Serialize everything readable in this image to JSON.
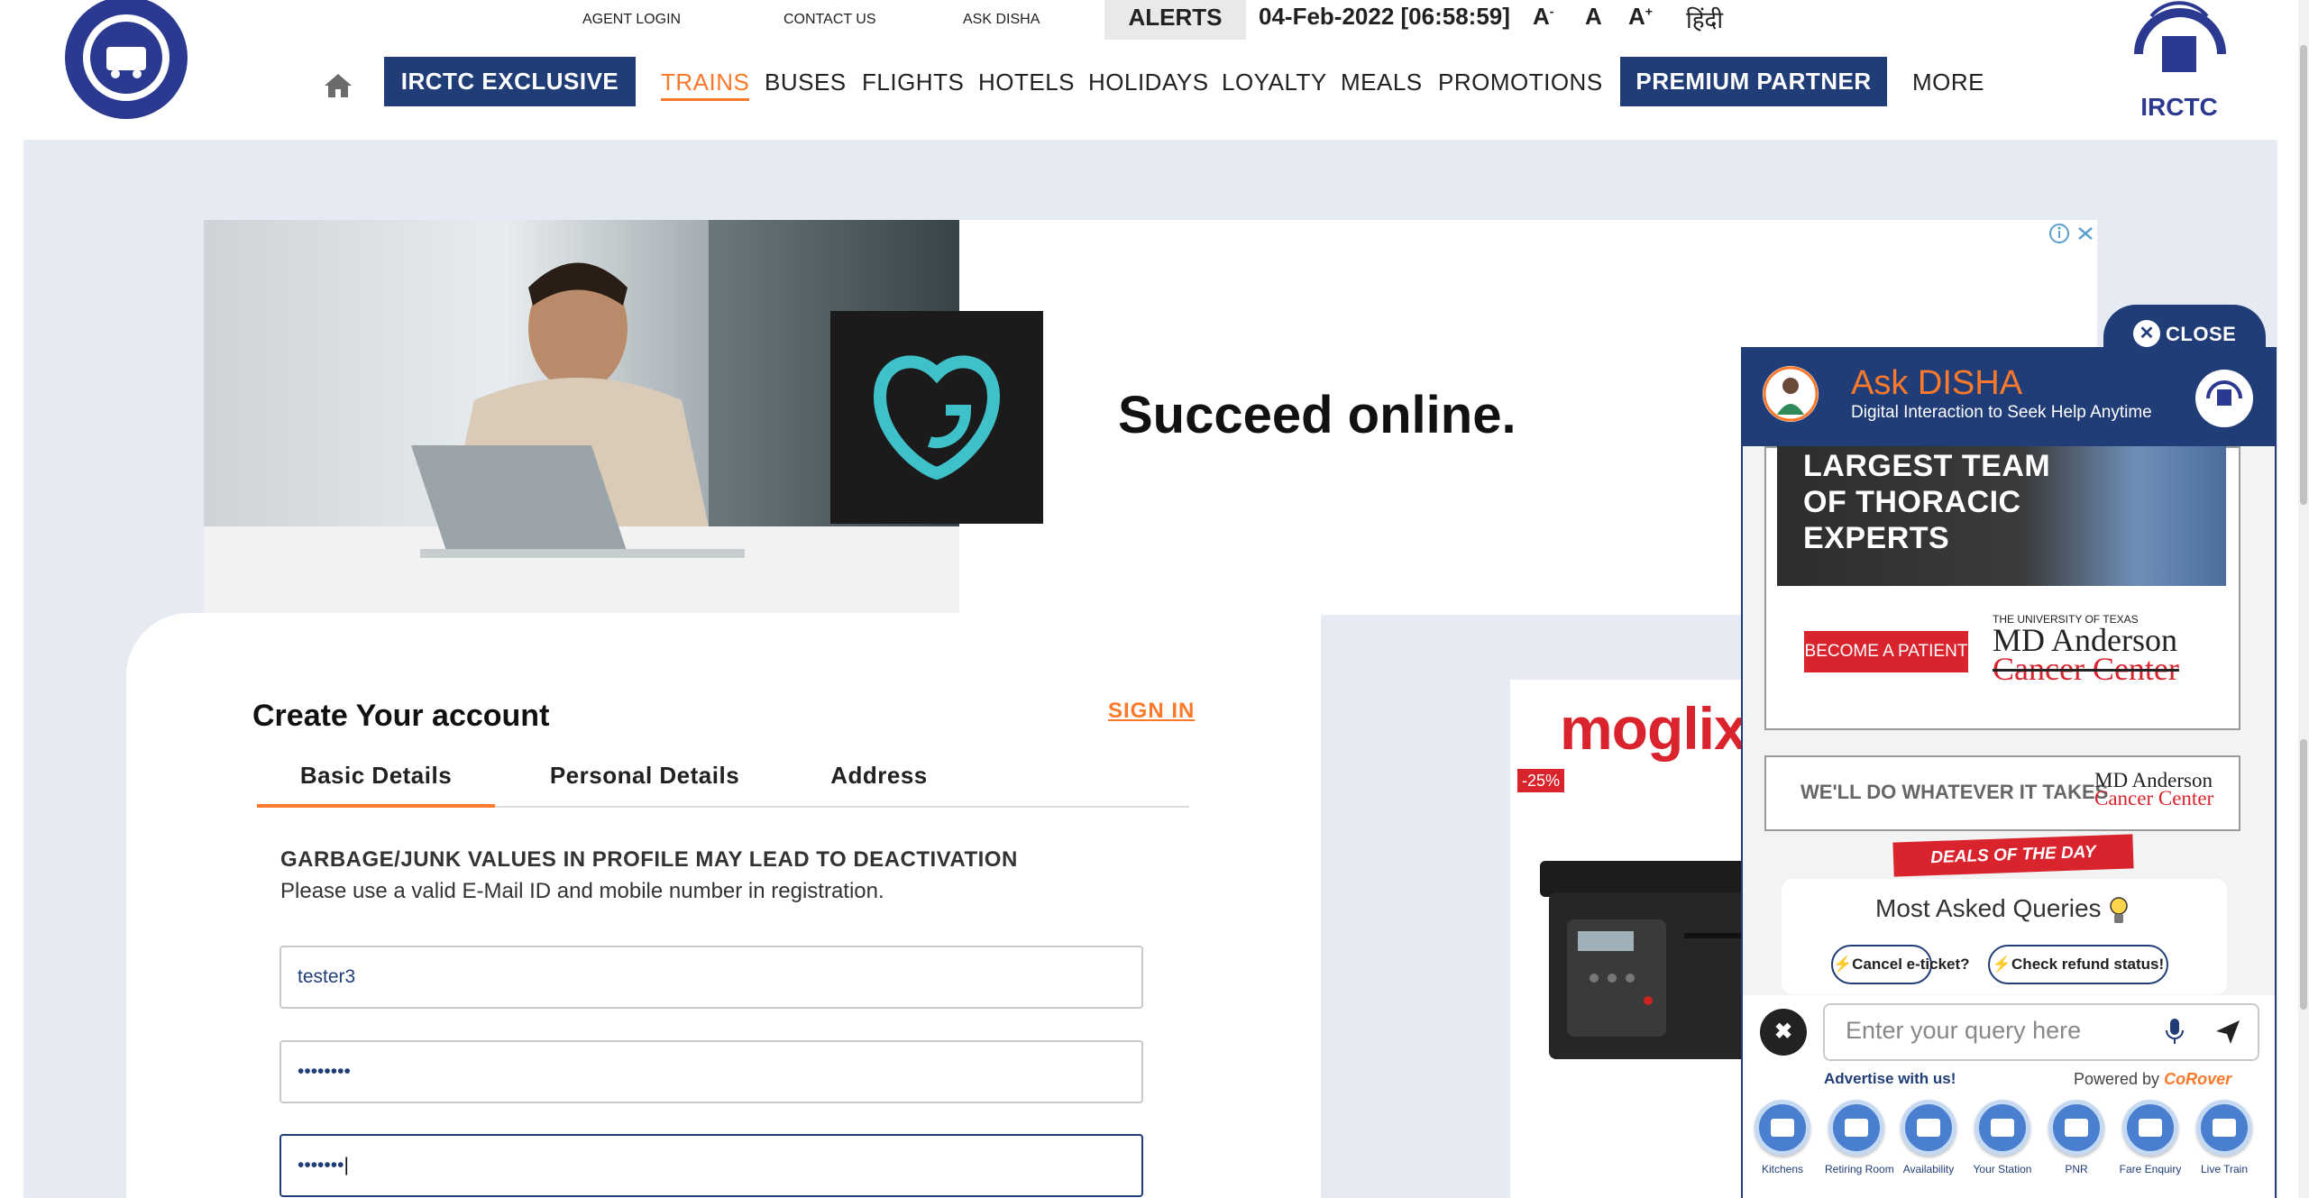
{
  "header": {
    "top_links": [
      "AGENT LOGIN",
      "CONTACT US",
      "ASK DISHA"
    ],
    "alerts": "ALERTS",
    "datetime": "04-Feb-2022 [06:58:59]",
    "font_small": "A",
    "font_small_sup": "-",
    "font_normal": "A",
    "font_large": "A",
    "font_large_sup": "+",
    "hindi": "हिंदी",
    "irctc_exclusive": "IRCTC EXCLUSIVE",
    "nav": [
      "TRAINS",
      "BUSES",
      "FLIGHTS",
      "HOTELS",
      "HOLIDAYS",
      "LOYALTY",
      "MEALS",
      "PROMOTIONS"
    ],
    "premium_partner": "PREMIUM PARTNER",
    "more": "MORE",
    "irctc_logo_text": "IRCTC"
  },
  "ad_banner": {
    "headline": "Succeed online."
  },
  "registration": {
    "title": "Create Your account",
    "sign_in": "SIGN IN",
    "tabs": [
      "Basic Details",
      "Personal Details",
      "Address"
    ],
    "warning": "GARBAGE/JUNK VALUES IN PROFILE MAY LEAD TO DEACTIVATION",
    "warning_sub": "Please use a valid E-Mail ID and mobile number in registration.",
    "fields": [
      {
        "value": "tester3"
      },
      {
        "value": "••••••••"
      },
      {
        "value": "•••••••"
      }
    ]
  },
  "product_ad": {
    "brand": "moglix",
    "discount": "-25%"
  },
  "disha": {
    "close": "CLOSE",
    "title": "Ask DISHA",
    "subtitle": "Digital Interaction to Seek Help Anytime",
    "ad_headline": [
      "LARGEST TEAM",
      "OF THORACIC",
      "EXPERTS"
    ],
    "ad_button": "BECOME A PATIENT",
    "ad_brand_small": "THE UNIVERSITY OF TEXAS",
    "ad_brand_line1": "MD Anderson",
    "ad_brand_line2": "Cancer Center",
    "ad2_text": "WE'LL DO WHATEVER IT TAKES",
    "deals": "DEALS OF THE DAY",
    "queries_title": "Most Asked Queries",
    "chips": [
      "Cancel e-ticket?",
      "Check refund status!"
    ],
    "input_placeholder": "Enter your query here",
    "advertise": "Advertise with us!",
    "powered_by": "Powered by",
    "powered_brand": "CoRover",
    "services": [
      "Kitchens",
      "Retiring Room",
      "Availability",
      "Your Station",
      "PNR",
      "Fare Enquiry",
      "Live Train"
    ]
  },
  "colors": {
    "navy": "#213d77",
    "orange": "#fb792b",
    "red": "#d9232d",
    "page_bg": "#e6ebf3"
  }
}
